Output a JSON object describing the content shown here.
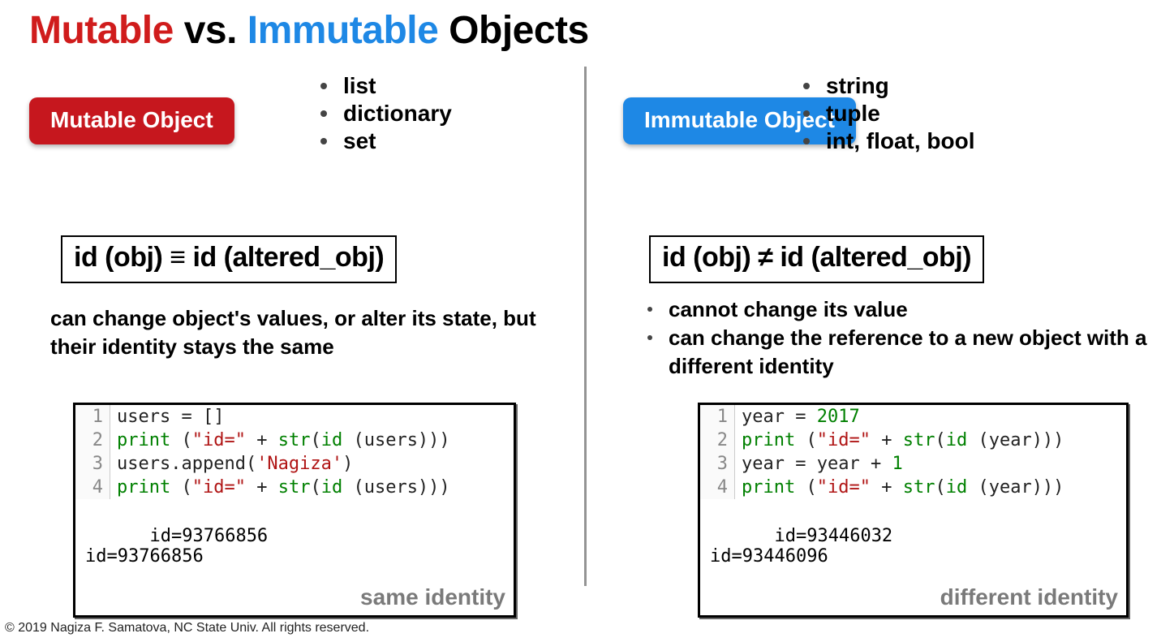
{
  "title": {
    "part1": "Mutable",
    "part2": "vs.",
    "part3": "Immutable",
    "part4": "Objects"
  },
  "left": {
    "pill": "Mutable Object",
    "types": [
      "list",
      "dictionary",
      "set"
    ],
    "equiv": "id (obj) ≡ id (altered_obj)",
    "explain": "can change object's values, or alter its state, but their identity stays the same",
    "code": {
      "lines": [
        {
          "n": "1",
          "tokens": [
            [
              "plain",
              "users = []"
            ]
          ]
        },
        {
          "n": "2",
          "tokens": [
            [
              "kw",
              "print"
            ],
            [
              "plain",
              " ("
            ],
            [
              "str",
              "\"id=\""
            ],
            [
              "plain",
              " + "
            ],
            [
              "kw",
              "str"
            ],
            [
              "plain",
              "("
            ],
            [
              "kw",
              "id"
            ],
            [
              "plain",
              " (users)))"
            ]
          ]
        },
        {
          "n": "3",
          "tokens": [
            [
              "plain",
              "users.append("
            ],
            [
              "str",
              "'Nagiza'"
            ],
            [
              "plain",
              ")"
            ]
          ]
        },
        {
          "n": "4",
          "tokens": [
            [
              "kw",
              "print"
            ],
            [
              "plain",
              " ("
            ],
            [
              "str",
              "\"id=\""
            ],
            [
              "plain",
              " + "
            ],
            [
              "kw",
              "str"
            ],
            [
              "plain",
              "("
            ],
            [
              "kw",
              "id"
            ],
            [
              "plain",
              " (users)))"
            ]
          ]
        }
      ],
      "output": "id=93766856\nid=93766856",
      "identity": "same identity"
    }
  },
  "right": {
    "pill": "Immutable Object",
    "types": [
      "string",
      "tuple",
      "int, float, bool"
    ],
    "equiv": "id (obj) ≠ id (altered_obj)",
    "explain": [
      "cannot change its value",
      "can change the reference to a new object with a different identity"
    ],
    "code": {
      "lines": [
        {
          "n": "1",
          "tokens": [
            [
              "plain",
              "year = "
            ],
            [
              "num",
              "2017"
            ]
          ]
        },
        {
          "n": "2",
          "tokens": [
            [
              "kw",
              "print"
            ],
            [
              "plain",
              " ("
            ],
            [
              "str",
              "\"id=\""
            ],
            [
              "plain",
              " + "
            ],
            [
              "kw",
              "str"
            ],
            [
              "plain",
              "("
            ],
            [
              "kw",
              "id"
            ],
            [
              "plain",
              " (year)))"
            ]
          ]
        },
        {
          "n": "3",
          "tokens": [
            [
              "plain",
              "year = year + "
            ],
            [
              "num",
              "1"
            ]
          ]
        },
        {
          "n": "4",
          "tokens": [
            [
              "kw",
              "print"
            ],
            [
              "plain",
              " ("
            ],
            [
              "str",
              "\"id=\""
            ],
            [
              "plain",
              " + "
            ],
            [
              "kw",
              "str"
            ],
            [
              "plain",
              "("
            ],
            [
              "kw",
              "id"
            ],
            [
              "plain",
              " (year)))"
            ]
          ]
        }
      ],
      "output": "id=93446032\nid=93446096",
      "identity": "different identity"
    }
  },
  "copyright": "© 2019  Nagiza F. Samatova, NC State Univ. All rights reserved."
}
